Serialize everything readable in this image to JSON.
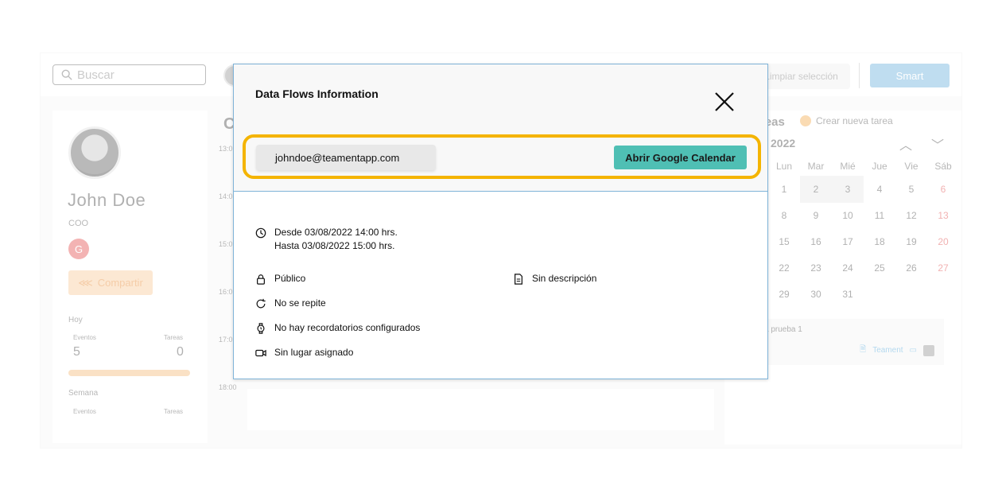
{
  "topbar": {
    "search_placeholder": "Buscar",
    "clear_label": "Limpiar selección",
    "smart_label": "Smart"
  },
  "profile": {
    "name": "John Doe",
    "role": "COO",
    "share_label": "Compartir",
    "today_label": "Hoy",
    "events_label": "Eventos",
    "tasks_label": "Tareas",
    "today_events": "5",
    "today_tasks": "0",
    "week_label": "Semana",
    "week_events_label": "Eventos",
    "week_tasks_label": "Tareas"
  },
  "calendar": {
    "times": [
      "13:0",
      "14:0",
      "15:0",
      "16:0",
      "17:0",
      "18:00"
    ]
  },
  "tasks": {
    "title": "reas",
    "new_task_label": "Crear nueva tarea",
    "year": "2022",
    "weekdays": [
      "Lun",
      "Mar",
      "Mié",
      "Jue",
      "Vie",
      "Sáb"
    ],
    "weeks": [
      [
        "1",
        "2",
        "3",
        "4",
        "5",
        "6"
      ],
      [
        "8",
        "9",
        "10",
        "11",
        "12",
        "13"
      ],
      [
        "15",
        "16",
        "17",
        "18",
        "19",
        "20"
      ],
      [
        "22",
        "23",
        "24",
        "25",
        "26",
        "27"
      ],
      [
        "29",
        "30",
        "31",
        "",
        "",
        ""
      ]
    ],
    "task_name": "a prueba 1",
    "task_tag": "Teament"
  },
  "modal": {
    "title": "Data Flows Information",
    "email": "johndoe@teamentapp.com",
    "gcal_button": "Abrir Google Calendar",
    "from": "Desde 03/08/2022 14:00 hrs.",
    "to": "Hasta 03/08/2022 15:00 hrs.",
    "visibility": "Público",
    "description": "Sin descripción",
    "repeat": "No se repite",
    "reminders": "No hay recordatorios configurados",
    "location": "Sin lugar asignado"
  },
  "colors": {
    "accent_teal": "#4fbfb4",
    "highlight": "#f4b400",
    "modal_border": "#7fb3d8"
  }
}
